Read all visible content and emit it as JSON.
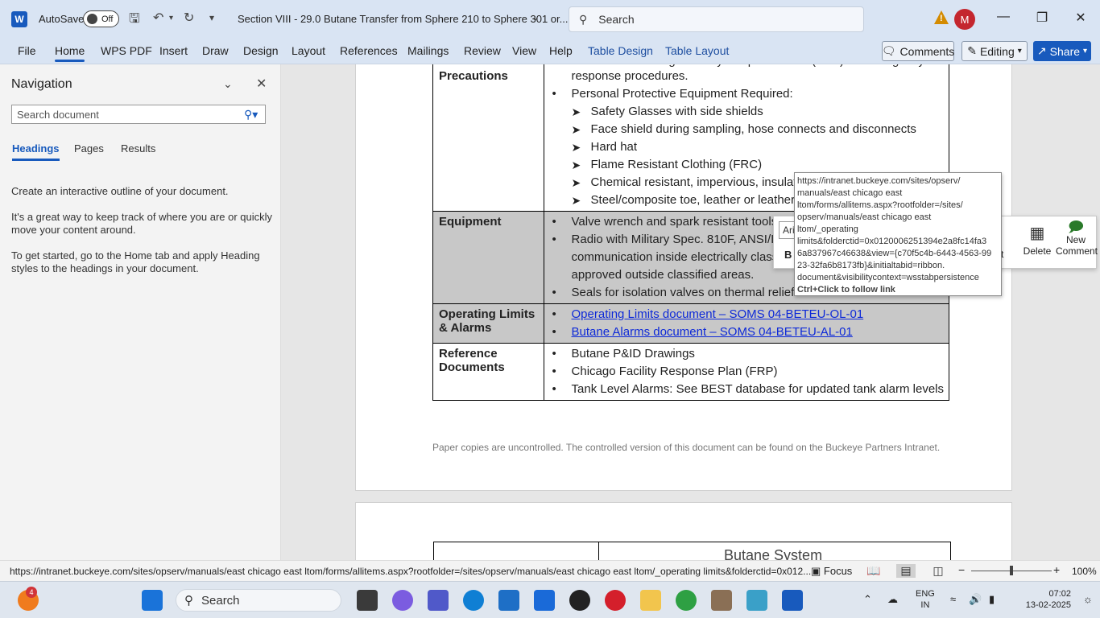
{
  "titlebar": {
    "autosave_label": "AutoSave",
    "autosave_state": "Off",
    "doc_title": "Section VIII - 29.0 Butane Transfer from Sphere 210 to Sphere 301 or...",
    "search_placeholder": "Search",
    "avatar_initial": "M"
  },
  "ribbon": {
    "tabs": [
      "File",
      "Home",
      "WPS PDF",
      "Insert",
      "Draw",
      "Design",
      "Layout",
      "References",
      "Mailings",
      "Review",
      "View",
      "Help",
      "Table Design",
      "Table Layout"
    ],
    "active_tab": "Home",
    "comments_label": "Comments",
    "editing_label": "Editing",
    "share_label": "Share"
  },
  "navigation": {
    "title": "Navigation",
    "search_placeholder": "Search document",
    "tabs": [
      "Headings",
      "Pages",
      "Results"
    ],
    "active_tab": "Headings",
    "paragraphs": [
      "Create an interactive outline of your document.",
      "It's a great way to keep track of where you are or quickly move your content around.",
      "To get started, go to the Home tab and apply Heading styles to the headings in your document."
    ]
  },
  "document": {
    "rows": [
      {
        "label": "Precautions",
        "items": [
          {
            "type": "bullet",
            "text": "Refer to the Chicago Facility Response Plan (FRP) for emergency"
          },
          {
            "type": "cont",
            "text": "response procedures."
          },
          {
            "type": "bullet",
            "text": "Personal Protective Equipment Required:"
          },
          {
            "type": "sub",
            "text": "Safety Glasses with side shields"
          },
          {
            "type": "sub",
            "text": "Face shield during sampling, hose connects and disconnects"
          },
          {
            "type": "sub",
            "text": "Hard hat"
          },
          {
            "type": "sub",
            "text": "Flame Resistant Clothing (FRC)"
          },
          {
            "type": "sub",
            "text": "Chemical resistant, impervious, insulated gloves"
          },
          {
            "type": "sub",
            "text": "Steel/composite toe, leather or leather-like boots"
          }
        ]
      },
      {
        "label": "Equipment",
        "items": [
          {
            "type": "bullet",
            "text": "Valve wrench and spark resistant tools"
          },
          {
            "type": "bullet",
            "text": "Radio with Military Spec. 810F, ANSI/ISA certified for"
          },
          {
            "type": "cont",
            "text": "communication inside electrically classified areas or"
          },
          {
            "type": "cont",
            "text": "approved outside classified areas."
          },
          {
            "type": "bullet",
            "text": "Seals for isolation valves on thermal relief circuits"
          }
        ]
      },
      {
        "label": "Operating Limits & Alarms",
        "items": [
          {
            "type": "link",
            "text": "Operating Limits document – SOMS 04-BETEU-OL-01"
          },
          {
            "type": "link",
            "text": "Butane Alarms document – SOMS 04-BETEU-AL-01"
          }
        ]
      },
      {
        "label": "Reference Documents",
        "items": [
          {
            "type": "bullet",
            "text": "Butane P&ID Drawings"
          },
          {
            "type": "bullet",
            "text": "Chicago Facility Response Plan (FRP)"
          },
          {
            "type": "bullet",
            "text": "Tank Level Alarms: See BEST database for updated tank alarm levels"
          }
        ]
      }
    ],
    "footer_note": "Paper copies are uncontrolled. The controlled version of this document can be found on the Buckeye Partners Intranet.",
    "next_page_title": "Butane System"
  },
  "mini_toolbar": {
    "font": "Aria",
    "bold": "B",
    "insert_fragment": "rt",
    "delete_label": "Delete",
    "new_comment_label": "New Comment"
  },
  "tooltip": {
    "lines": [
      "https://intranet.buckeye.com/sites/opserv/",
      "manuals/east chicago east",
      "ltom/forms/allitems.aspx?rootfolder=/sites/",
      "opserv/manuals/east chicago east",
      "ltom/_operating",
      "limits&folderctid=0x0120006251394e2a8fc14fa3",
      "6a837967c46638&view={c70f5c4b-6443-4563-99",
      "23-32fa6b8173fb}&initialtabid=ribbon.",
      "document&visibilitycontext=wsstabpersistence"
    ],
    "hint": "Ctrl+Click to follow link"
  },
  "statusbar": {
    "url": "https://intranet.buckeye.com/sites/opserv/manuals/east chicago east ltom/forms/allitems.aspx?rootfolder=/sites/opserv/manuals/east chicago east ltom/_operating limits&folderctid=0x012...",
    "focus_label": "Focus",
    "zoom": "100%",
    "zoom_fraction": 0.5
  },
  "taskbar": {
    "search_label": "Search",
    "notification_count": "4",
    "lang_line1": "ENG",
    "lang_line2": "IN",
    "time": "07:02",
    "date": "13-02-2025"
  }
}
